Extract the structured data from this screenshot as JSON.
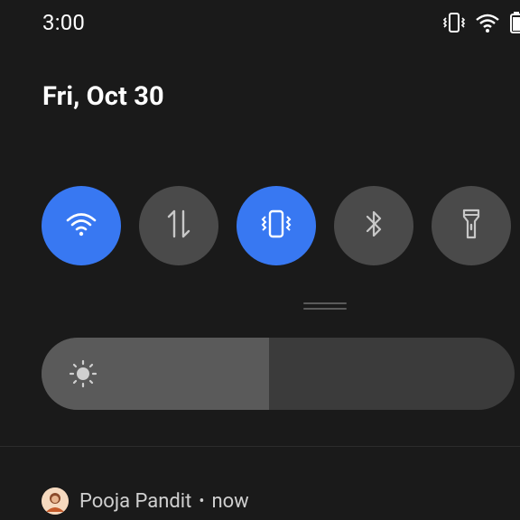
{
  "status_bar": {
    "time": "3:00",
    "icons": [
      "vibrate-icon",
      "wifi-icon",
      "battery-icon"
    ]
  },
  "date": "Fri, Oct 30",
  "quick_tiles": [
    {
      "name": "wifi",
      "icon": "wifi-icon",
      "active": true
    },
    {
      "name": "mobile-data",
      "icon": "data-arrows-icon",
      "active": false
    },
    {
      "name": "vibrate",
      "icon": "vibrate-icon",
      "active": true
    },
    {
      "name": "bluetooth",
      "icon": "bluetooth-icon",
      "active": false
    },
    {
      "name": "flashlight",
      "icon": "flashlight-icon",
      "active": false
    }
  ],
  "brightness": {
    "level": 0.48,
    "icon": "brightness-icon"
  },
  "notification": {
    "sender": "Pooja Pandit",
    "separator": "•",
    "time": "now"
  },
  "colors": {
    "background": "#1a1a1a",
    "accent": "#3878f2",
    "tile_inactive": "#4a4a4a",
    "slider_track": "#3b3b3b",
    "slider_fill": "#5a5a5a"
  }
}
